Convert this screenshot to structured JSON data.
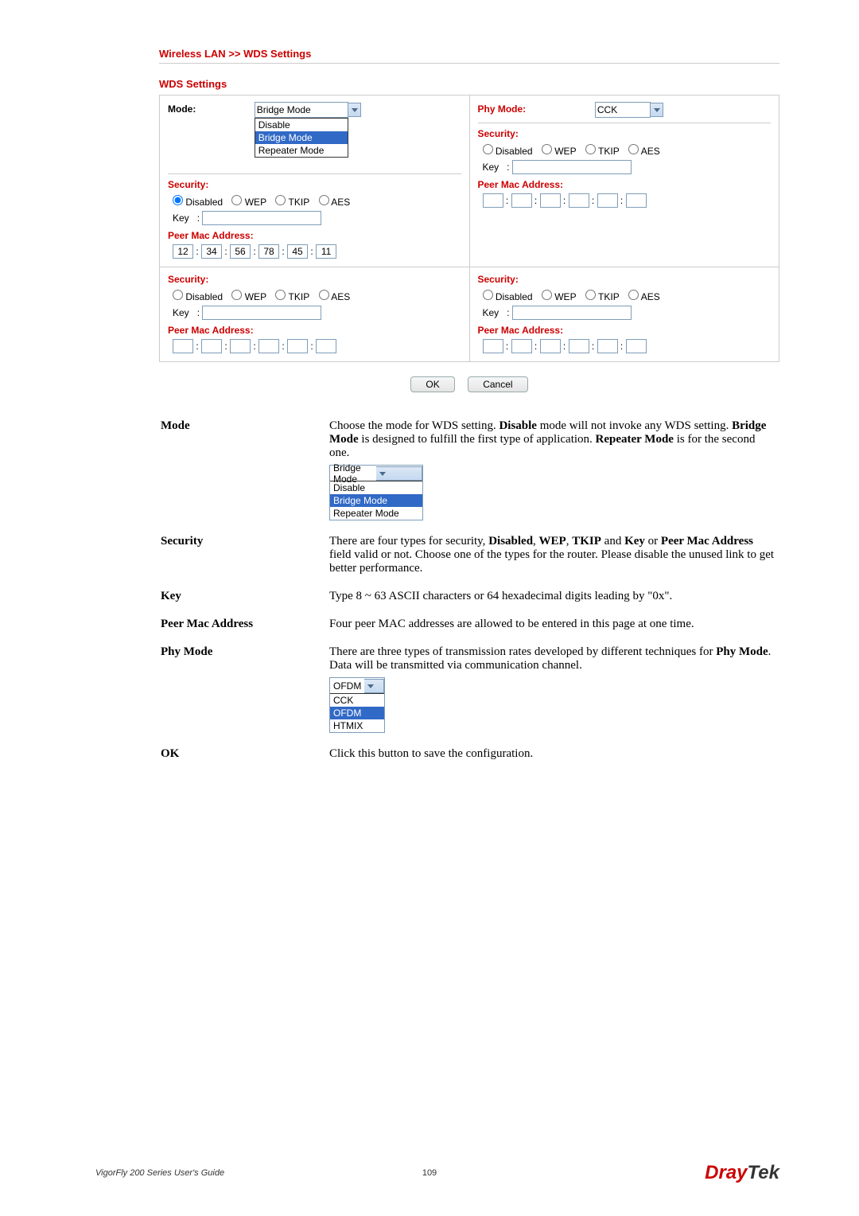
{
  "breadcrumb": "Wireless LAN >> WDS Settings",
  "wds_title": "WDS Settings",
  "mode_label": "Mode:",
  "phy_label": "Phy Mode:",
  "mode_select": {
    "selected": "Bridge Mode",
    "options": [
      "Disable",
      "Bridge Mode",
      "Repeater Mode"
    ]
  },
  "phy_select": {
    "selected": "CCK"
  },
  "sec_label": "Security:",
  "sec_opts": {
    "disabled": "Disabled",
    "wep": "WEP",
    "tkip": "TKIP",
    "aes": "AES"
  },
  "key_label": "Key",
  "peer_label": "Peer Mac Address:",
  "mac1": [
    "12",
    "34",
    "56",
    "78",
    "45",
    "11"
  ],
  "btn_ok": "OK",
  "btn_cancel": "Cancel",
  "desc": {
    "mode": {
      "label": "Mode",
      "text": "Choose the mode for WDS setting. ",
      "t2": " mode will not invoke any WDS setting. ",
      "t3": " is designed to fulfill the first type of application. ",
      "t4": " is for the second one.",
      "b1": "Disable",
      "b2": "Bridge Mode",
      "b3": "Repeater Mode"
    },
    "dd_mode": {
      "selected": "Bridge Mode",
      "options": [
        "Disable",
        "Bridge Mode",
        "Repeater Mode"
      ]
    },
    "security": {
      "label": "Security",
      "text1": "There are four types for security, ",
      "b1": "Disabled",
      "b2": "WEP",
      "b3": "TKIP",
      "t2": " and ",
      "b4": "Key",
      "t3": " or ",
      "b5": "Peer Mac Address",
      "t4": " field valid or not. Choose one of the types for the router. Please disable the unused link to get better performance."
    },
    "key": {
      "label": "Key",
      "text": "Type 8 ~ 63 ASCII characters or 64 hexadecimal digits leading by \"0x\"."
    },
    "peer": {
      "label": "Peer Mac Address",
      "text": "Four peer MAC addresses are allowed to be entered in this page at one time."
    },
    "phy": {
      "label": "Phy Mode",
      "text1": "There are three types of transmission rates developed by different techniques for ",
      "b1": "Phy Mode",
      "text2": ". Data will be transmitted via communication channel."
    },
    "dd_phy": {
      "selected": "OFDM",
      "options": [
        "CCK",
        "OFDM",
        "HTMIX"
      ]
    },
    "ok": {
      "label": "OK",
      "text": "Click this button to save the configuration."
    }
  },
  "footer": {
    "left": "VigorFly 200 Series User's Guide",
    "page": "109"
  }
}
